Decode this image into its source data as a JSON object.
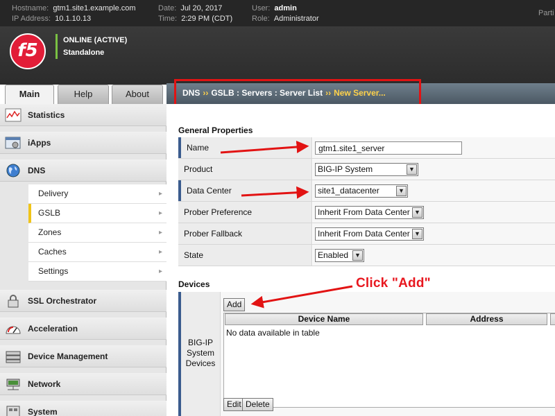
{
  "topbar": {
    "hostname_label": "Hostname:",
    "hostname": "gtm1.site1.example.com",
    "ip_label": "IP Address:",
    "ip": "10.1.10.13",
    "date_label": "Date:",
    "date": "Jul 20, 2017",
    "time_label": "Time:",
    "time": "2:29 PM (CDT)",
    "user_label": "User:",
    "user": "admin",
    "role_label": "Role:",
    "role": "Administrator",
    "partition_label": "Parti"
  },
  "banner": {
    "logo_text": "f5",
    "status_line1": "ONLINE (ACTIVE)",
    "status_line2": "Standalone",
    "status_color": "#7ac143"
  },
  "tabs": [
    {
      "label": "Main",
      "active": true
    },
    {
      "label": "Help",
      "active": false
    },
    {
      "label": "About",
      "active": false
    }
  ],
  "breadcrumb": {
    "dns": "DNS",
    "sep": "››",
    "path": "GSLB : Servers : Server List",
    "current": "New Server..."
  },
  "sidebar": {
    "items": [
      {
        "label": "Statistics",
        "icon": "statistics-icon"
      },
      {
        "label": "iApps",
        "icon": "iapps-icon"
      },
      {
        "label": "DNS",
        "icon": "globe-icon"
      },
      {
        "label": "SSL Orchestrator",
        "icon": "lock-icon"
      },
      {
        "label": "Acceleration",
        "icon": "gauge-icon"
      },
      {
        "label": "Device Management",
        "icon": "device-icon"
      },
      {
        "label": "Network",
        "icon": "network-icon"
      },
      {
        "label": "System",
        "icon": "system-icon"
      }
    ],
    "dns_subitems": [
      {
        "label": "Delivery",
        "active": false
      },
      {
        "label": "GSLB",
        "active": true
      },
      {
        "label": "Zones",
        "active": false
      },
      {
        "label": "Caches",
        "active": false
      },
      {
        "label": "Settings",
        "active": false
      }
    ],
    "active_accent": "#f0c419"
  },
  "general": {
    "section_title": "General Properties",
    "rows": [
      {
        "label": "Name",
        "type": "text",
        "value": "gtm1.site1_server",
        "required": true
      },
      {
        "label": "Product",
        "type": "select",
        "value": "BIG-IP System",
        "required": false
      },
      {
        "label": "Data Center",
        "type": "select",
        "value": "site1_datacenter",
        "required": true
      },
      {
        "label": "Prober Preference",
        "type": "select",
        "value": "Inherit From Data Center",
        "required": false
      },
      {
        "label": "Prober Fallback",
        "type": "select",
        "value": "Inherit From Data Center",
        "required": false
      },
      {
        "label": "State",
        "type": "select",
        "value": "Enabled",
        "required": false
      }
    ]
  },
  "devices": {
    "section_title": "Devices",
    "row_label_1": "BIG-IP",
    "row_label_2": "System",
    "row_label_3": "Devices",
    "add_button": "Add",
    "columns": [
      "Device Name",
      "Address"
    ],
    "empty_text": "No data available in table",
    "edit_button": "Edit",
    "delete_button": "Delete"
  },
  "annotations": {
    "callout_text": "Click \"Add\"",
    "color": "#e21313"
  }
}
